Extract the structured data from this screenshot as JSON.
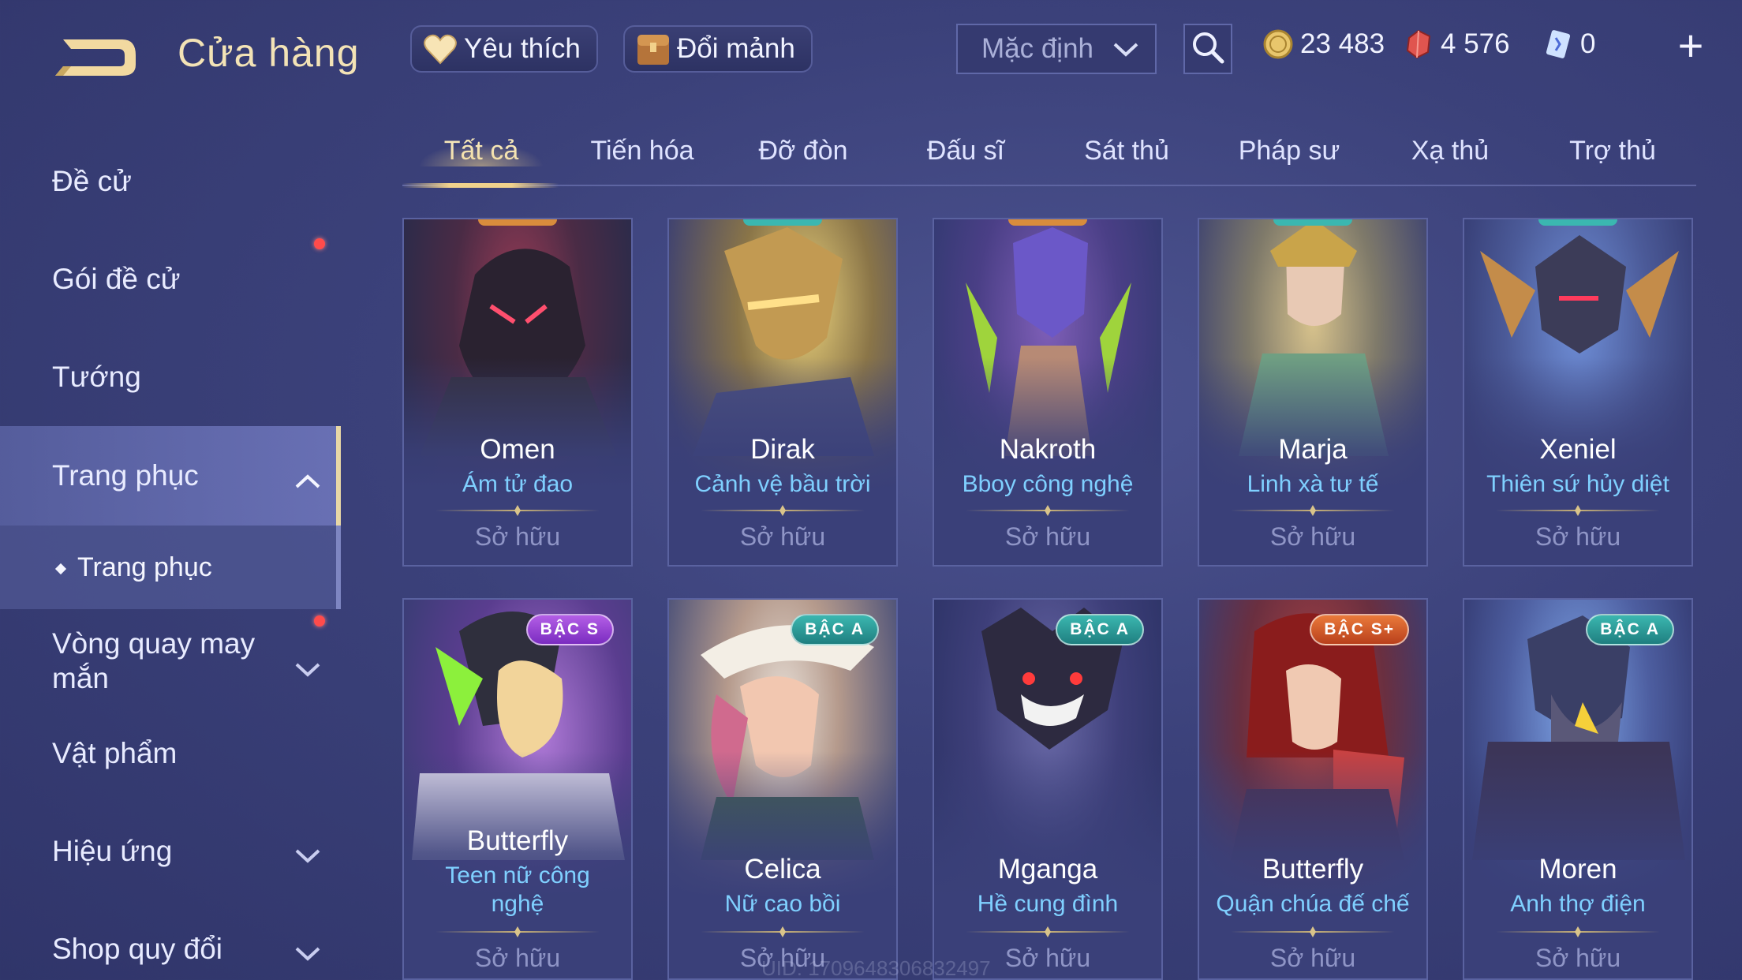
{
  "header": {
    "title": "Cửa hàng",
    "favorites_label": "Yêu thích",
    "exchange_label": "Đổi mảnh",
    "sort_value": "Mặc định",
    "gold": "23 483",
    "gems": "4 576",
    "vouchers": "0",
    "plus": "+"
  },
  "sidebar": {
    "items": [
      {
        "label": "Đề cử"
      },
      {
        "label": "Gói đề cử"
      },
      {
        "label": "Tướng"
      },
      {
        "label": "Trang phục"
      },
      {
        "label": "Vòng quay may mắn"
      },
      {
        "label": "Vật phẩm"
      },
      {
        "label": "Hiệu ứng"
      },
      {
        "label": "Shop quy đổi"
      }
    ],
    "sub_item": "Trang phục"
  },
  "tabs": [
    {
      "label": "Tất cả"
    },
    {
      "label": "Tiến hóa"
    },
    {
      "label": "Đỡ đòn"
    },
    {
      "label": "Đấu sĩ"
    },
    {
      "label": "Sát thủ"
    },
    {
      "label": "Pháp sư"
    },
    {
      "label": "Xạ thủ"
    },
    {
      "label": "Trợ thủ"
    }
  ],
  "cards": [
    {
      "hero": "Omen",
      "skin": "Ám tử đao",
      "status": "Sở hữu"
    },
    {
      "hero": "Dirak",
      "skin": "Cảnh vệ bầu trời",
      "status": "Sở hữu"
    },
    {
      "hero": "Nakroth",
      "skin": "Bboy công nghệ",
      "status": "Sở hữu"
    },
    {
      "hero": "Marja",
      "skin": "Linh xà tư tế",
      "status": "Sở hữu"
    },
    {
      "hero": "Xeniel",
      "skin": "Thiên sứ hủy diệt",
      "status": "Sở hữu"
    },
    {
      "hero": "Butterfly",
      "skin": "Teen nữ công nghệ",
      "status": "Sở hữu",
      "tier": "BẬC S"
    },
    {
      "hero": "Celica",
      "skin": "Nữ cao bồi",
      "status": "Sở hữu",
      "tier": "BẬC A"
    },
    {
      "hero": "Mganga",
      "skin": "Hề cung đình",
      "status": "Sở hữu",
      "tier": "BẬC A"
    },
    {
      "hero": "Butterfly",
      "skin": "Quận chúa đế chế",
      "status": "Sở hữu",
      "tier": "BẬC S+"
    },
    {
      "hero": "Moren",
      "skin": "Anh thợ điện",
      "status": "Sở hữu",
      "tier": "BẬC A"
    }
  ],
  "uid_watermark": "UID: 1709648306832497",
  "colors": {
    "accent_gold": "#f0d28c",
    "skin_name_blue": "#7fd0ff",
    "background": "#3b417a"
  }
}
